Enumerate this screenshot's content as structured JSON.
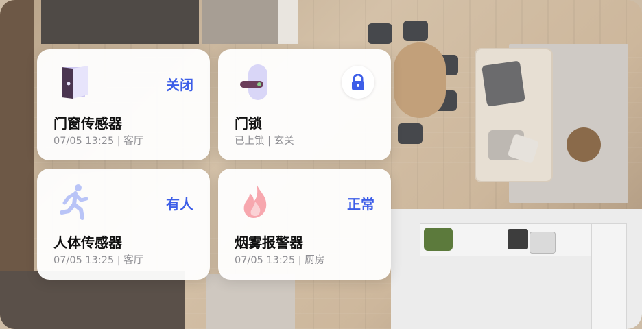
{
  "cards": [
    {
      "name": "门窗传感器",
      "status": "关闭",
      "time": "07/05 13:25",
      "separator": "|",
      "location": "客厅",
      "icon": "door-icon"
    },
    {
      "name": "门锁",
      "status_text": "已上锁",
      "separator": "|",
      "location": "玄关",
      "icon": "smart-lock-icon",
      "action_icon": "padlock-icon"
    },
    {
      "name": "人体传感器",
      "status": "有人",
      "time": "07/05 13:25",
      "separator": "|",
      "location": "客厅",
      "icon": "running-person-icon"
    },
    {
      "name": "烟雾报警器",
      "status": "正常",
      "time": "07/05 13:25",
      "separator": "|",
      "location": "厨房",
      "icon": "flame-icon"
    }
  ],
  "colors": {
    "accent": "#3d5ee8",
    "card_bg": "#ffffff",
    "muted": "#8e8e93",
    "title": "#111111"
  }
}
